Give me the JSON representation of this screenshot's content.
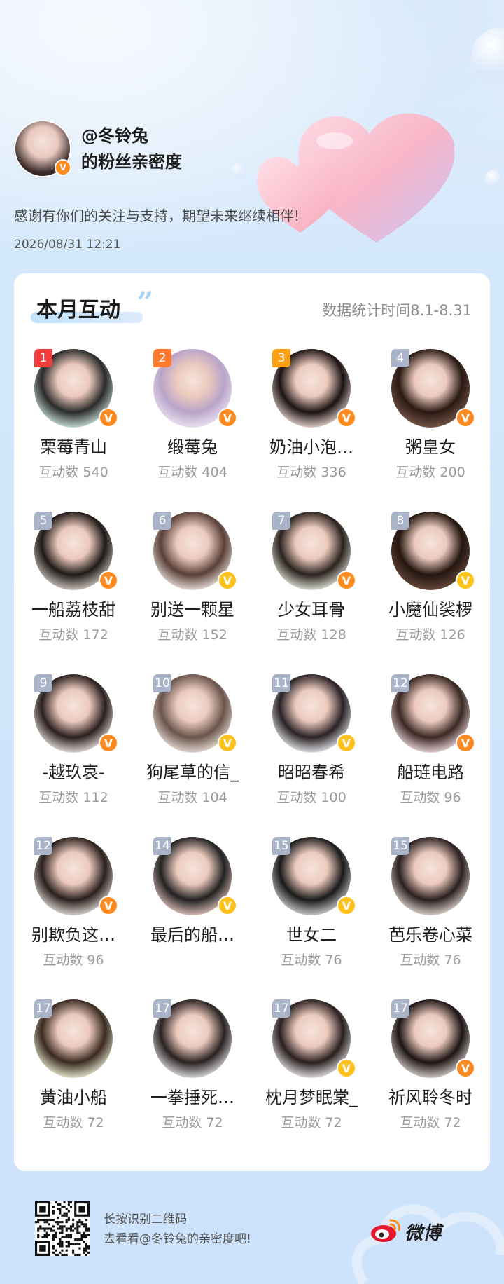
{
  "header": {
    "owner_name": "@冬铃兔",
    "subtitle": "的粉丝亲密度",
    "thanks": "感谢有你们的关注与支持，期望未来继续相伴!",
    "datetime": "2026/08/31  12:21"
  },
  "card": {
    "title": "本月互动",
    "quote_mark": "”",
    "stat_range": "数据统计时间8.1-8.31"
  },
  "count_prefix": "互动数 ",
  "fans": [
    {
      "rank": "1",
      "name": "栗莓青山",
      "count": "540",
      "badge": "orange"
    },
    {
      "rank": "2",
      "name": "缎莓兔",
      "count": "404",
      "badge": "orange"
    },
    {
      "rank": "3",
      "name": "奶油小泡…",
      "count": "336",
      "badge": "orange"
    },
    {
      "rank": "4",
      "name": "粥皇女",
      "count": "200",
      "badge": "orange"
    },
    {
      "rank": "5",
      "name": "一船荔枝甜",
      "count": "172",
      "badge": "orange"
    },
    {
      "rank": "6",
      "name": "别送一颗星",
      "count": "152",
      "badge": "gold"
    },
    {
      "rank": "7",
      "name": "少女耳骨",
      "count": "128",
      "badge": "orange"
    },
    {
      "rank": "8",
      "name": "小魔仙裟椤",
      "count": "126",
      "badge": "gold"
    },
    {
      "rank": "9",
      "name": "-越玖哀-",
      "count": "112",
      "badge": "orange"
    },
    {
      "rank": "10",
      "name": "狗尾草的信_",
      "count": "104",
      "badge": "gold"
    },
    {
      "rank": "11",
      "name": "昭昭春希",
      "count": "100",
      "badge": "gold"
    },
    {
      "rank": "12",
      "name": "船琏电路",
      "count": "96",
      "badge": "orange"
    },
    {
      "rank": "12",
      "name": "别欺负这…",
      "count": "96",
      "badge": "orange"
    },
    {
      "rank": "14",
      "name": "最后的船…",
      "count": "",
      "badge": "gold"
    },
    {
      "rank": "15",
      "name": "世女二",
      "count": "76",
      "badge": "gold"
    },
    {
      "rank": "15",
      "name": "芭乐卷心菜",
      "count": "76",
      "badge": "none"
    },
    {
      "rank": "17",
      "name": "黄油小船",
      "count": "72",
      "badge": "none"
    },
    {
      "rank": "17",
      "name": "一拳捶死…",
      "count": "72",
      "badge": "none"
    },
    {
      "rank": "17",
      "name": "枕月梦眠棠_",
      "count": "72",
      "badge": "gold"
    },
    {
      "rank": "17",
      "name": "祈风聆冬时",
      "count": "72",
      "badge": "orange"
    }
  ],
  "footer": {
    "line1": "长按识别二维码",
    "line2": "去看看@冬铃兔的亲密度吧!",
    "brand": "微博"
  },
  "badge_text": "V",
  "colors": {
    "rank1": "#f23d3d",
    "rank2": "#ff7a2e",
    "rank3": "#ffa114",
    "rank_other": "#aab4c8",
    "v_orange": "#ff8a1f",
    "v_gold": "#ffc21a",
    "accent_blue": "#a9d3f6"
  },
  "icons": [
    "verified-v-icon",
    "weibo-logo-icon",
    "qr-code-icon",
    "heart-decoration-icon",
    "quote-icon"
  ]
}
